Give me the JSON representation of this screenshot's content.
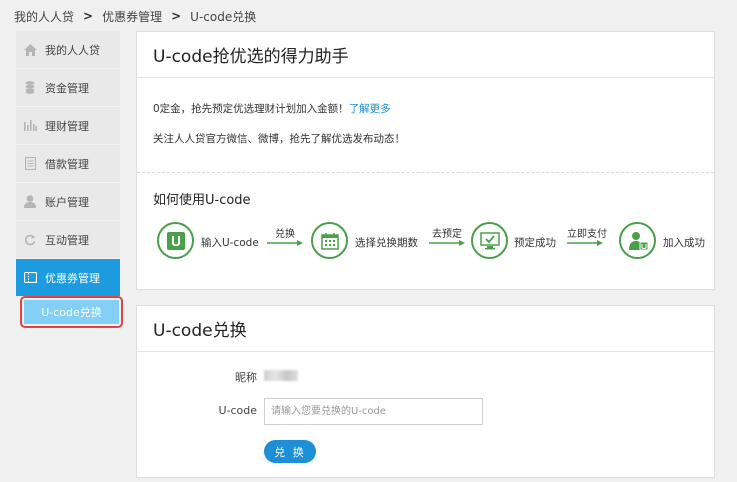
{
  "breadcrumb": {
    "items": [
      "我的人人贷",
      "优惠券管理",
      "U-code兑换"
    ],
    "separator": ">"
  },
  "sidebar": {
    "items": [
      {
        "label": "我的人人贷",
        "icon": "home-icon"
      },
      {
        "label": "资金管理",
        "icon": "coins-icon"
      },
      {
        "label": "理财管理",
        "icon": "bar-chart-icon"
      },
      {
        "label": "借款管理",
        "icon": "document-icon"
      },
      {
        "label": "账户管理",
        "icon": "user-icon"
      },
      {
        "label": "互动管理",
        "icon": "refresh-icon"
      },
      {
        "label": "优惠券管理",
        "icon": "coupon-icon"
      }
    ],
    "sub_item": {
      "label": "U-code兑换"
    }
  },
  "intro": {
    "title": "U-code抢优选的得力助手",
    "line1": "0定金，抢先预定优选理财计划加入金额！",
    "line1_link": "了解更多",
    "line2": "关注人人贷官方微信、微博，抢先了解优选发布动态！",
    "howto_title": "如何使用U-code",
    "steps": [
      "输入U-code",
      "选择兑换期数",
      "预定成功",
      "加入成功"
    ],
    "arrows": [
      "兑换",
      "去预定",
      "立即支付"
    ]
  },
  "redeem": {
    "title": "U-code兑换",
    "nickname_label": "昵称",
    "ucode_label": "U-code",
    "ucode_placeholder": "请输入您要兑换的U-code",
    "submit_label": "兑 换"
  },
  "colors": {
    "accent": "#1c9be0",
    "sub_active": "#84cff5",
    "highlight": "#e24343",
    "step_green": "#4aa04a",
    "link": "#1c8fd6"
  }
}
